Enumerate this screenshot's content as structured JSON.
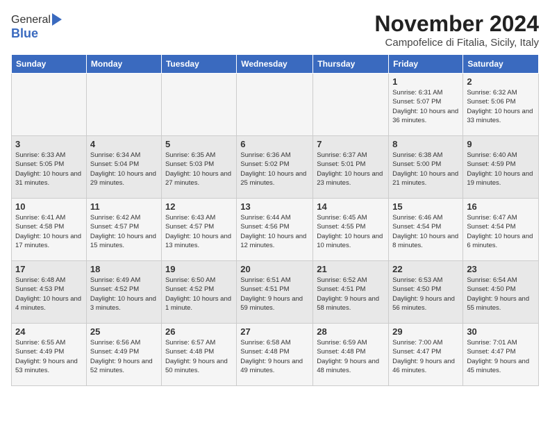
{
  "logo": {
    "line1": "General",
    "line2": "Blue"
  },
  "title": "November 2024",
  "subtitle": "Campofelice di Fitalia, Sicily, Italy",
  "days_of_week": [
    "Sunday",
    "Monday",
    "Tuesday",
    "Wednesday",
    "Thursday",
    "Friday",
    "Saturday"
  ],
  "weeks": [
    [
      {
        "day": "",
        "info": ""
      },
      {
        "day": "",
        "info": ""
      },
      {
        "day": "",
        "info": ""
      },
      {
        "day": "",
        "info": ""
      },
      {
        "day": "",
        "info": ""
      },
      {
        "day": "1",
        "info": "Sunrise: 6:31 AM\nSunset: 5:07 PM\nDaylight: 10 hours and 36 minutes."
      },
      {
        "day": "2",
        "info": "Sunrise: 6:32 AM\nSunset: 5:06 PM\nDaylight: 10 hours and 33 minutes."
      }
    ],
    [
      {
        "day": "3",
        "info": "Sunrise: 6:33 AM\nSunset: 5:05 PM\nDaylight: 10 hours and 31 minutes."
      },
      {
        "day": "4",
        "info": "Sunrise: 6:34 AM\nSunset: 5:04 PM\nDaylight: 10 hours and 29 minutes."
      },
      {
        "day": "5",
        "info": "Sunrise: 6:35 AM\nSunset: 5:03 PM\nDaylight: 10 hours and 27 minutes."
      },
      {
        "day": "6",
        "info": "Sunrise: 6:36 AM\nSunset: 5:02 PM\nDaylight: 10 hours and 25 minutes."
      },
      {
        "day": "7",
        "info": "Sunrise: 6:37 AM\nSunset: 5:01 PM\nDaylight: 10 hours and 23 minutes."
      },
      {
        "day": "8",
        "info": "Sunrise: 6:38 AM\nSunset: 5:00 PM\nDaylight: 10 hours and 21 minutes."
      },
      {
        "day": "9",
        "info": "Sunrise: 6:40 AM\nSunset: 4:59 PM\nDaylight: 10 hours and 19 minutes."
      }
    ],
    [
      {
        "day": "10",
        "info": "Sunrise: 6:41 AM\nSunset: 4:58 PM\nDaylight: 10 hours and 17 minutes."
      },
      {
        "day": "11",
        "info": "Sunrise: 6:42 AM\nSunset: 4:57 PM\nDaylight: 10 hours and 15 minutes."
      },
      {
        "day": "12",
        "info": "Sunrise: 6:43 AM\nSunset: 4:57 PM\nDaylight: 10 hours and 13 minutes."
      },
      {
        "day": "13",
        "info": "Sunrise: 6:44 AM\nSunset: 4:56 PM\nDaylight: 10 hours and 12 minutes."
      },
      {
        "day": "14",
        "info": "Sunrise: 6:45 AM\nSunset: 4:55 PM\nDaylight: 10 hours and 10 minutes."
      },
      {
        "day": "15",
        "info": "Sunrise: 6:46 AM\nSunset: 4:54 PM\nDaylight: 10 hours and 8 minutes."
      },
      {
        "day": "16",
        "info": "Sunrise: 6:47 AM\nSunset: 4:54 PM\nDaylight: 10 hours and 6 minutes."
      }
    ],
    [
      {
        "day": "17",
        "info": "Sunrise: 6:48 AM\nSunset: 4:53 PM\nDaylight: 10 hours and 4 minutes."
      },
      {
        "day": "18",
        "info": "Sunrise: 6:49 AM\nSunset: 4:52 PM\nDaylight: 10 hours and 3 minutes."
      },
      {
        "day": "19",
        "info": "Sunrise: 6:50 AM\nSunset: 4:52 PM\nDaylight: 10 hours and 1 minute."
      },
      {
        "day": "20",
        "info": "Sunrise: 6:51 AM\nSunset: 4:51 PM\nDaylight: 9 hours and 59 minutes."
      },
      {
        "day": "21",
        "info": "Sunrise: 6:52 AM\nSunset: 4:51 PM\nDaylight: 9 hours and 58 minutes."
      },
      {
        "day": "22",
        "info": "Sunrise: 6:53 AM\nSunset: 4:50 PM\nDaylight: 9 hours and 56 minutes."
      },
      {
        "day": "23",
        "info": "Sunrise: 6:54 AM\nSunset: 4:50 PM\nDaylight: 9 hours and 55 minutes."
      }
    ],
    [
      {
        "day": "24",
        "info": "Sunrise: 6:55 AM\nSunset: 4:49 PM\nDaylight: 9 hours and 53 minutes."
      },
      {
        "day": "25",
        "info": "Sunrise: 6:56 AM\nSunset: 4:49 PM\nDaylight: 9 hours and 52 minutes."
      },
      {
        "day": "26",
        "info": "Sunrise: 6:57 AM\nSunset: 4:48 PM\nDaylight: 9 hours and 50 minutes."
      },
      {
        "day": "27",
        "info": "Sunrise: 6:58 AM\nSunset: 4:48 PM\nDaylight: 9 hours and 49 minutes."
      },
      {
        "day": "28",
        "info": "Sunrise: 6:59 AM\nSunset: 4:48 PM\nDaylight: 9 hours and 48 minutes."
      },
      {
        "day": "29",
        "info": "Sunrise: 7:00 AM\nSunset: 4:47 PM\nDaylight: 9 hours and 46 minutes."
      },
      {
        "day": "30",
        "info": "Sunrise: 7:01 AM\nSunset: 4:47 PM\nDaylight: 9 hours and 45 minutes."
      }
    ]
  ]
}
